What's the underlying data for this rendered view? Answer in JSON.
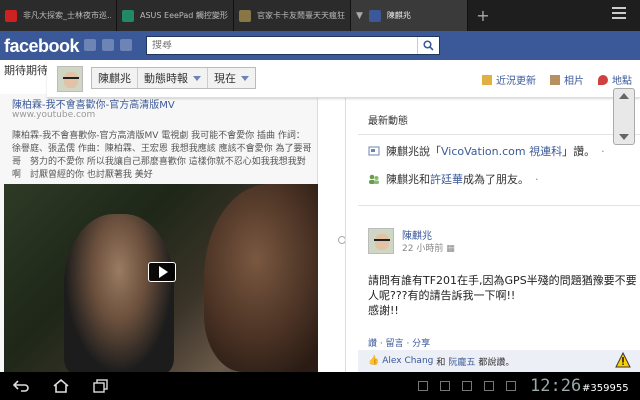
{
  "browser": {
    "tabs": [
      {
        "label": "非凡大探索_士林夜市巡...",
        "favicon_color": "#cc2222",
        "active": false
      },
      {
        "label": "ASUS EeePad 觸控變形...",
        "favicon_color": "#228866",
        "active": false
      },
      {
        "label": "官家卡卡友鬧臺天天瘋狂...",
        "favicon_color": "#887744",
        "active": false
      },
      {
        "label": "陳麒兆",
        "favicon_color": "#3b5998",
        "active": true
      }
    ],
    "new_tab": "+"
  },
  "facebook": {
    "logo": "facebook",
    "search_placeholder": "搜尋",
    "brand_color": "#3b5998"
  },
  "page": {
    "top_strip_text": "期待期待"
  },
  "header": {
    "name_button": "陳麒兆",
    "feed_button": "動態時報",
    "now_button": "現在",
    "recent_updates": "近況更新",
    "photos": "相片",
    "places": "地點"
  },
  "shared_post": {
    "title": "陳柏霖-我不會喜歡你-官方高清版MV",
    "url": "www.youtube.com",
    "description": "陳柏霖-我不會喜歡你-官方高清版MV 電視劇 我可能不會愛你 插曲 作詞：徐譽庭、張孟儒 作曲：陳柏霖、王宏恩 我想我應該 應該不會愛你 為了要哥哥　努力的不愛你 所以我讓自己那麼喜歡你 這樣你就不忍心如我我想我對啊　討厭曾經的你 也討厭著我 美好"
  },
  "recent_activity": {
    "heading": "最新動態",
    "items": [
      {
        "prefix": "陳麒兆說「",
        "link": "VicoVation.com 視連科",
        "suffix": "」讚。",
        "dot": "·"
      },
      {
        "prefix": "陳麒兆和",
        "link": "許廷華",
        "suffix": "成為了朋友。",
        "dot": "·"
      }
    ]
  },
  "status_post": {
    "author": "陳麒兆",
    "time": "22 小時前",
    "body_line1": "請問有誰有TF201在手,因為GPS半殘的問題猶豫要不要",
    "body_line2": "人呢???有的請告訴我一下啊!!",
    "body_line3": "感謝!!",
    "actions": "讚 · 留言 · 分享",
    "likes_prefix": "",
    "likes_name1": "Alex Chang",
    "likes_mid": "和",
    "likes_name2": "阮龐五",
    "likes_suffix": "都說讚。"
  },
  "system": {
    "clock": "12:26",
    "watermark": "#359955"
  }
}
